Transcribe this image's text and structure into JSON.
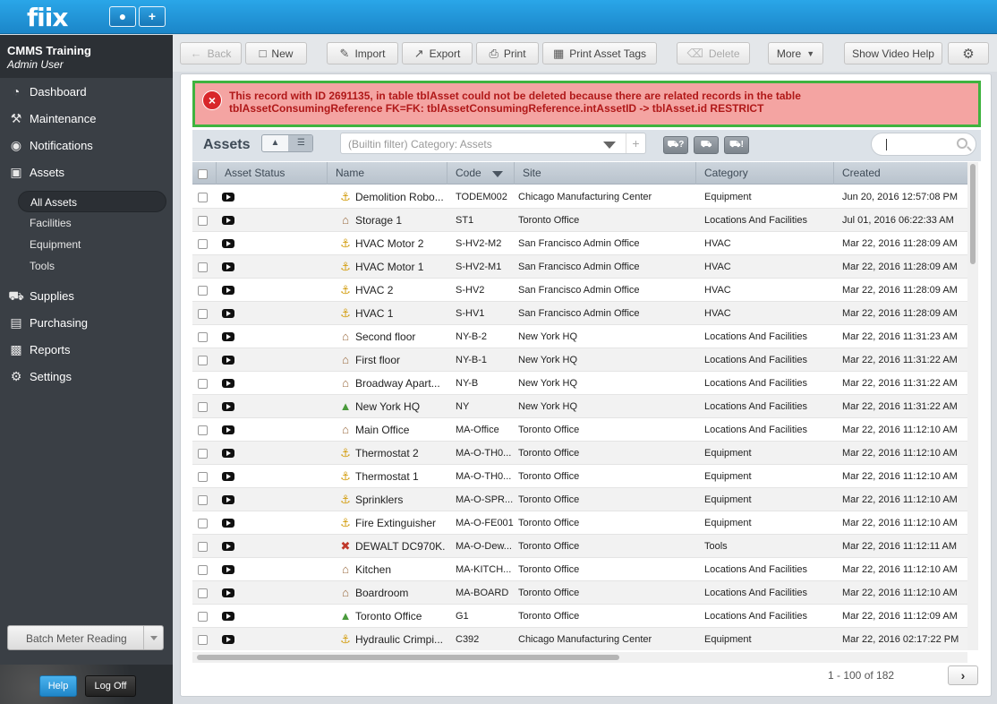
{
  "app": {
    "logo": "fiix",
    "user_icon": "user-icon",
    "add_icon": "plus-icon"
  },
  "sidebar": {
    "org_name": "CMMS Training",
    "org_user": "Admin User",
    "nav": [
      {
        "label": "Dashboard",
        "icon": "dashboard-icon"
      },
      {
        "label": "Maintenance",
        "icon": "wrench-icon"
      },
      {
        "label": "Notifications",
        "icon": "speech-bubble-icon"
      },
      {
        "label": "Assets",
        "icon": "boxes-icon"
      },
      {
        "label": "Supplies",
        "icon": "truck-icon"
      },
      {
        "label": "Purchasing",
        "icon": "cart-icon"
      },
      {
        "label": "Reports",
        "icon": "chart-icon"
      },
      {
        "label": "Settings",
        "icon": "gear-icon"
      }
    ],
    "sub": [
      "All Assets",
      "Facilities",
      "Equipment",
      "Tools"
    ],
    "batch_label": "Batch Meter Reading",
    "help_label": "Help",
    "logoff_label": "Log Off"
  },
  "toolbar": {
    "back": "Back",
    "new": "New",
    "import": "Import",
    "export": "Export",
    "print": "Print",
    "print_tags": "Print Asset Tags",
    "delete": "Delete",
    "more": "More",
    "video": "Show Video Help"
  },
  "error": {
    "line1": "This record with ID 2691135, in table tblAsset could not be deleted because there are related records in the table",
    "line2": "tblAssetConsumingReference FK=FK: tblAssetConsumingReference.intAssetID -> tblAsset.id RESTRICT"
  },
  "list": {
    "title": "Assets",
    "filter_placeholder": "(Builtin filter) Category: Assets",
    "mini1": "?",
    "mini3": "!",
    "search_value": ""
  },
  "columns": {
    "status": "Asset Status",
    "name": "Name",
    "code": "Code",
    "site": "Site",
    "category": "Category",
    "created": "Created"
  },
  "rows": [
    {
      "icon": "forklift",
      "name": "Demolition Robo...",
      "code": "TODEM002",
      "site": "Chicago Manufacturing Center",
      "category": "Equipment",
      "created": "Jun 20, 2016 12:57:08 PM"
    },
    {
      "icon": "building",
      "name": "Storage 1",
      "code": "ST1",
      "site": "Toronto Office",
      "category": "Locations And Facilities",
      "created": "Jul 01, 2016 06:22:33 AM"
    },
    {
      "icon": "forklift",
      "name": "HVAC Motor 2",
      "code": "S-HV2-M2",
      "site": "San Francisco Admin Office",
      "category": "HVAC",
      "created": "Mar 22, 2016 11:28:09 AM"
    },
    {
      "icon": "forklift",
      "name": "HVAC Motor 1",
      "code": "S-HV2-M1",
      "site": "San Francisco Admin Office",
      "category": "HVAC",
      "created": "Mar 22, 2016 11:28:09 AM"
    },
    {
      "icon": "forklift",
      "name": "HVAC 2",
      "code": "S-HV2",
      "site": "San Francisco Admin Office",
      "category": "HVAC",
      "created": "Mar 22, 2016 11:28:09 AM"
    },
    {
      "icon": "forklift",
      "name": "HVAC 1",
      "code": "S-HV1",
      "site": "San Francisco Admin Office",
      "category": "HVAC",
      "created": "Mar 22, 2016 11:28:09 AM"
    },
    {
      "icon": "building",
      "name": "Second floor",
      "code": "NY-B-2",
      "site": "New York HQ",
      "category": "Locations And Facilities",
      "created": "Mar 22, 2016 11:31:23 AM"
    },
    {
      "icon": "building",
      "name": "First floor",
      "code": "NY-B-1",
      "site": "New York HQ",
      "category": "Locations And Facilities",
      "created": "Mar 22, 2016 11:31:22 AM"
    },
    {
      "icon": "building",
      "name": "Broadway Apart...",
      "code": "NY-B",
      "site": "New York HQ",
      "category": "Locations And Facilities",
      "created": "Mar 22, 2016 11:31:22 AM"
    },
    {
      "icon": "site",
      "name": "New York HQ",
      "code": "NY",
      "site": "New York HQ",
      "category": "Locations And Facilities",
      "created": "Mar 22, 2016 11:31:22 AM"
    },
    {
      "icon": "building",
      "name": "Main Office",
      "code": "MA-Office",
      "site": "Toronto Office",
      "category": "Locations And Facilities",
      "created": "Mar 22, 2016 11:12:10 AM"
    },
    {
      "icon": "forklift",
      "name": "Thermostat 2",
      "code": "MA-O-TH0...",
      "site": "Toronto Office",
      "category": "Equipment",
      "created": "Mar 22, 2016 11:12:10 AM"
    },
    {
      "icon": "forklift",
      "name": "Thermostat 1",
      "code": "MA-O-TH0...",
      "site": "Toronto Office",
      "category": "Equipment",
      "created": "Mar 22, 2016 11:12:10 AM"
    },
    {
      "icon": "forklift",
      "name": "Sprinklers",
      "code": "MA-O-SPR...",
      "site": "Toronto Office",
      "category": "Equipment",
      "created": "Mar 22, 2016 11:12:10 AM"
    },
    {
      "icon": "forklift",
      "name": "Fire Extinguisher",
      "code": "MA-O-FE001",
      "site": "Toronto Office",
      "category": "Equipment",
      "created": "Mar 22, 2016 11:12:10 AM"
    },
    {
      "icon": "tools",
      "name": "DEWALT DC970K...",
      "code": "MA-O-Dew...",
      "site": "Toronto Office",
      "category": "Tools",
      "created": "Mar 22, 2016 11:12:11 AM"
    },
    {
      "icon": "building",
      "name": "Kitchen",
      "code": "MA-KITCH...",
      "site": "Toronto Office",
      "category": "Locations And Facilities",
      "created": "Mar 22, 2016 11:12:10 AM"
    },
    {
      "icon": "building",
      "name": "Boardroom",
      "code": "MA-BOARD",
      "site": "Toronto Office",
      "category": "Locations And Facilities",
      "created": "Mar 22, 2016 11:12:10 AM"
    },
    {
      "icon": "site",
      "name": "Toronto Office",
      "code": "G1",
      "site": "Toronto Office",
      "category": "Locations And Facilities",
      "created": "Mar 22, 2016 11:12:09 AM"
    },
    {
      "icon": "forklift",
      "name": "Hydraulic Crimpi...",
      "code": "C392",
      "site": "Chicago Manufacturing Center",
      "category": "Equipment",
      "created": "Mar 22, 2016 02:17:22 PM"
    }
  ],
  "pager": {
    "text": "1 - 100 of 182",
    "next": "›"
  },
  "colors": {
    "accent": "#1b86c9",
    "error_bg": "#f4a4a2",
    "error_border": "#3fb33f",
    "error_text": "#b01818",
    "sidebar": "#3a3f45"
  }
}
